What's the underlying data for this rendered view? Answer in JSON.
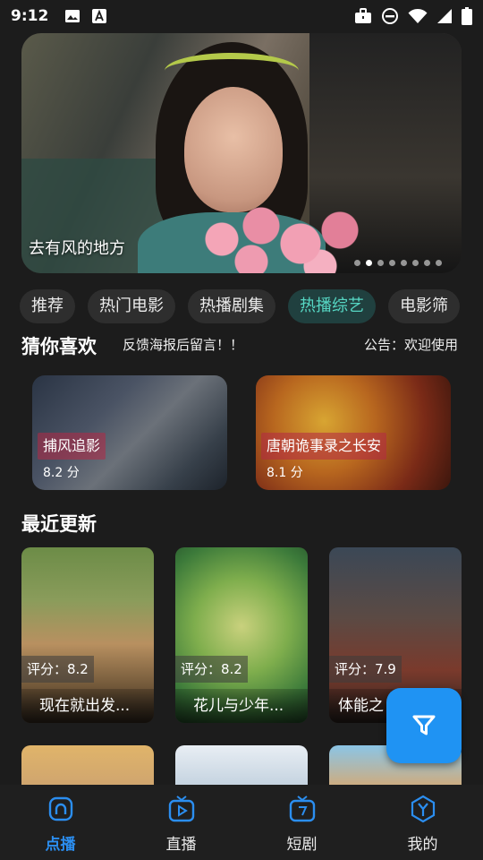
{
  "status_bar": {
    "time": "9:12"
  },
  "banner": {
    "caption": "去有风的地方",
    "dots_total": 8,
    "active_dot": 1
  },
  "tabs": [
    {
      "label": "推荐",
      "active": false
    },
    {
      "label": "热门电影",
      "active": false
    },
    {
      "label": "热播剧集",
      "active": false
    },
    {
      "label": "热播综艺",
      "active": true
    },
    {
      "label": "电影筛",
      "active": false
    }
  ],
  "guess": {
    "title": "猜你喜欢",
    "marquee_left": "反馈海报后留言！！",
    "marquee_right": "公告：欢迎使用",
    "items": [
      {
        "title": "捕风追影",
        "score": "8.2 分"
      },
      {
        "title": "唐朝诡事录之长安",
        "score": "8.1 分"
      }
    ]
  },
  "recent": {
    "title": "最近更新",
    "items": [
      {
        "score": "评分：8.2",
        "title": "现在就出发..."
      },
      {
        "score": "评分：8.2",
        "title": "花儿与少年..."
      },
      {
        "score": "评分：7.9",
        "title": "体能之"
      }
    ]
  },
  "fab": {
    "icon": "filter-icon"
  },
  "bottom_nav": [
    {
      "label": "点播",
      "icon": "home-icon",
      "active": true
    },
    {
      "label": "直播",
      "icon": "live-tv-icon",
      "active": false
    },
    {
      "label": "短剧",
      "icon": "short-drama-icon",
      "active": false
    },
    {
      "label": "我的",
      "icon": "profile-icon",
      "active": false
    }
  ],
  "colors": {
    "accent": "#2b8ef0",
    "tab_active_bg": "#20403f",
    "tab_active_text": "#56d6c3",
    "fab": "#1f93f3",
    "background": "#1c1c1c"
  }
}
